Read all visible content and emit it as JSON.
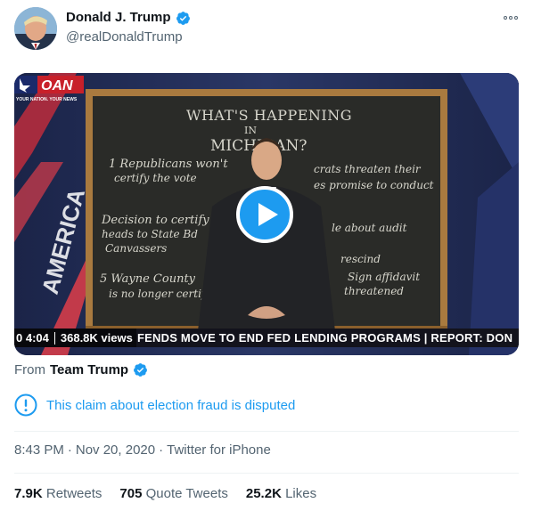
{
  "author": {
    "display_name": "Donald J. Trump",
    "handle": "@realDonaldTrump",
    "verified": true
  },
  "video": {
    "chalkboard_lines": [
      "WHAT'S HAPPENING",
      "IN",
      "MICHIGAN?",
      "1 Republicans won't",
      "certify the vote",
      "crats threaten their",
      "es promise to conduct",
      "Decision to certify",
      "heads to State Bd",
      "Canvassers",
      "le about audit",
      "5 Wayne County",
      "is no longer certif",
      "rescind",
      "Sign affidavit",
      "threatened"
    ],
    "network_logo": "OAN",
    "network_tagline": "YOUR NATION. YOUR NEWS",
    "duration": "0 4:04",
    "views": "368.8K views",
    "ticker": "FENDS MOVE TO END FED LENDING PROGRAMS  |  REPORT: DON"
  },
  "source": {
    "label": "From",
    "name": "Team Trump"
  },
  "notice": {
    "text": "This claim about election fraud is disputed"
  },
  "meta": {
    "time": "8:43 PM",
    "date": "Nov 20, 2020",
    "client": "Twitter for iPhone"
  },
  "stats": {
    "retweets_count": "7.9K",
    "retweets_label": "Retweets",
    "quotes_count": "705",
    "quotes_label": "Quote Tweets",
    "likes_count": "25.2K",
    "likes_label": "Likes"
  },
  "colors": {
    "accent": "#1d9bf0",
    "verified": "#1d9bf0",
    "secondary_text": "#536471"
  }
}
